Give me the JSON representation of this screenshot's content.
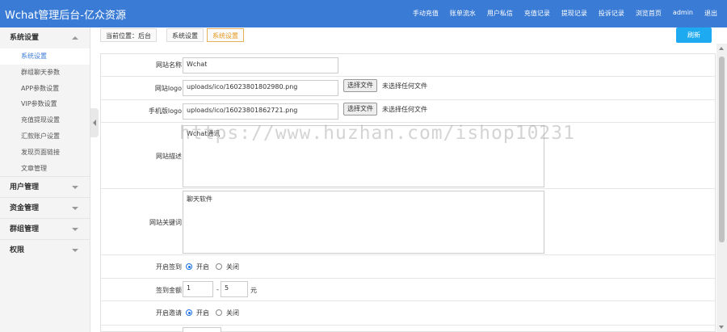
{
  "topbar": {
    "title": "Wchat管理后台-亿众资源",
    "nav": [
      "手动充值",
      "账单流水",
      "用户私信",
      "充值记录",
      "提现记录",
      "投诉记录",
      "浏览首页",
      "admin",
      "退出"
    ],
    "bg_color": "#3a7bd5"
  },
  "sidebar": {
    "groups": [
      {
        "label": "系统设置",
        "expanded": true,
        "items": [
          "系统设置",
          "群组聊天参数",
          "APP参数设置",
          "VIP参数设置",
          "充值提现设置",
          "汇款账户设置",
          "发现页面链接",
          "文章管理"
        ],
        "active_index": 0
      },
      {
        "label": "用户管理",
        "expanded": false
      },
      {
        "label": "资金管理",
        "expanded": false
      },
      {
        "label": "群组管理",
        "expanded": false
      },
      {
        "label": "权限",
        "expanded": false
      }
    ]
  },
  "breadcrumb": {
    "items": [
      "当前位置：后台",
      "系统设置",
      "系统设置"
    ],
    "current_color": "#e69a1f"
  },
  "refresh_label": "刷新",
  "form": {
    "site_name": {
      "label": "网站名称",
      "value": "Wchat"
    },
    "site_logo": {
      "label": "网站logo",
      "value": "uploads/ico/16023801802980.png",
      "button": "选择文件",
      "status": "未选择任何文件"
    },
    "mobile_logo": {
      "label": "手机版logo",
      "value": "uploads/ico/16023801862721.png",
      "button": "选择文件",
      "status": "未选择任何文件"
    },
    "description": {
      "label": "网站描述",
      "value": "Wchat通讯"
    },
    "keywords": {
      "label": "网站关键词",
      "value": "聊天软件"
    },
    "checkin": {
      "label": "开启签到",
      "on": "开启",
      "off": "关闭",
      "selected": "开启"
    },
    "checkin_amount": {
      "label": "签到金额",
      "min": "1",
      "sep": "-",
      "max": "5",
      "unit": "元"
    },
    "invite": {
      "label": "开启邀请",
      "on": "开启",
      "off": "关闭",
      "selected": "开启"
    }
  },
  "watermark": "https://www.huzhan.com/ishop10231"
}
